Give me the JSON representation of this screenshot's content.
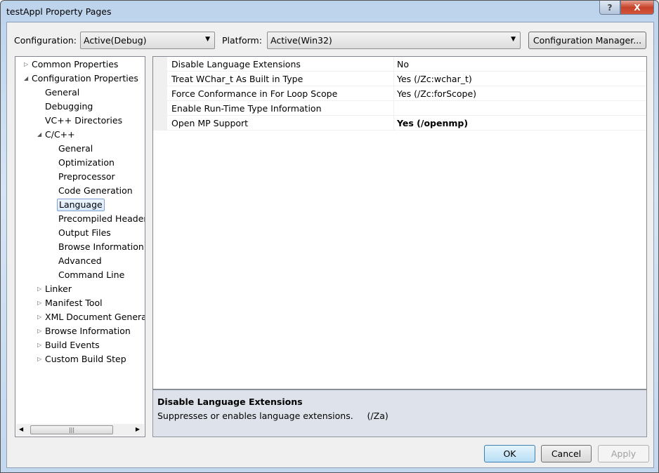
{
  "window": {
    "title": "testAppl Property Pages",
    "help_icon": "?",
    "close_icon": "X"
  },
  "toolbar": {
    "configuration_label": "Configuration:",
    "configuration_value": "Active(Debug)",
    "platform_label": "Platform:",
    "platform_value": "Active(Win32)",
    "config_manager_label": "Configuration Manager..."
  },
  "tree": [
    {
      "label": "Common Properties",
      "level": 0,
      "expander": "collapsed"
    },
    {
      "label": "Configuration Properties",
      "level": 0,
      "expander": "expanded"
    },
    {
      "label": "General",
      "level": 1
    },
    {
      "label": "Debugging",
      "level": 1
    },
    {
      "label": "VC++ Directories",
      "level": 1
    },
    {
      "label": "C/C++",
      "level": 1,
      "expander": "expanded"
    },
    {
      "label": "General",
      "level": 2
    },
    {
      "label": "Optimization",
      "level": 2
    },
    {
      "label": "Preprocessor",
      "level": 2
    },
    {
      "label": "Code Generation",
      "level": 2
    },
    {
      "label": "Language",
      "level": 2,
      "selected": true
    },
    {
      "label": "Precompiled Headers",
      "level": 2
    },
    {
      "label": "Output Files",
      "level": 2
    },
    {
      "label": "Browse Information",
      "level": 2
    },
    {
      "label": "Advanced",
      "level": 2
    },
    {
      "label": "Command Line",
      "level": 2
    },
    {
      "label": "Linker",
      "level": 1,
      "expander": "collapsed"
    },
    {
      "label": "Manifest Tool",
      "level": 1,
      "expander": "collapsed"
    },
    {
      "label": "XML Document Generator",
      "level": 1,
      "expander": "collapsed"
    },
    {
      "label": "Browse Information",
      "level": 1,
      "expander": "collapsed"
    },
    {
      "label": "Build Events",
      "level": 1,
      "expander": "collapsed"
    },
    {
      "label": "Custom Build Step",
      "level": 1,
      "expander": "collapsed"
    }
  ],
  "properties": [
    {
      "name": "Disable Language Extensions",
      "value": "No",
      "bold": false
    },
    {
      "name": "Treat WChar_t As Built in Type",
      "value": "Yes (/Zc:wchar_t)",
      "bold": false
    },
    {
      "name": "Force Conformance in For Loop Scope",
      "value": "Yes (/Zc:forScope)",
      "bold": false
    },
    {
      "name": "Enable Run-Time Type Information",
      "value": "",
      "bold": false
    },
    {
      "name": "Open MP Support",
      "value": "Yes (/openmp)",
      "bold": true
    }
  ],
  "description": {
    "title": "Disable Language Extensions",
    "text": "Suppresses or enables language extensions.     (/Za)"
  },
  "buttons": {
    "ok": "OK",
    "cancel": "Cancel",
    "apply": "Apply"
  }
}
